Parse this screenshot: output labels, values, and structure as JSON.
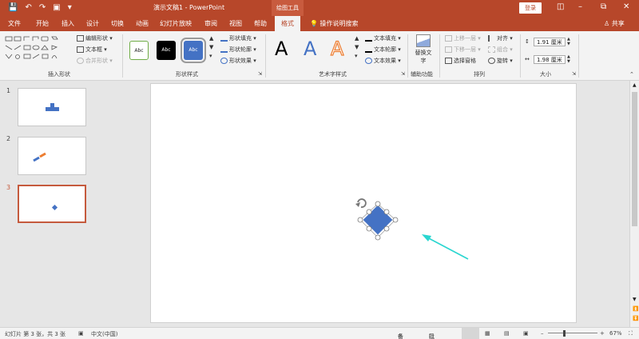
{
  "window": {
    "title": "演示文稿1 - PowerPoint",
    "context_tab_group": "绘图工具",
    "login_label": "登录"
  },
  "menu": {
    "tabs": [
      "文件",
      "开始",
      "插入",
      "设计",
      "切换",
      "动画",
      "幻灯片放映",
      "审阅",
      "视图",
      "帮助",
      "格式"
    ],
    "tell_me": "操作说明搜索",
    "share": "共享"
  },
  "ribbon": {
    "insert_shapes": {
      "label": "插入形状",
      "edit_shape": "编辑形状",
      "text_box": "文本框",
      "merge_shapes": "合并形状"
    },
    "shape_styles": {
      "label": "形状样式",
      "preset_text": "Abc",
      "fill": "形状填充",
      "outline": "形状轮廓",
      "effects": "形状效果"
    },
    "wordart": {
      "label": "艺术字样式",
      "letter": "A",
      "fill": "文本填充",
      "outline": "文本轮廓",
      "effects": "文本效果"
    },
    "accessibility": {
      "label": "辅助功能",
      "alt_text": "替换文字"
    },
    "arrange": {
      "label": "排列",
      "bring_forward": "上移一层",
      "send_backward": "下移一层",
      "selection_pane": "选择窗格",
      "align": "对齐",
      "group": "组合",
      "rotate": "旋转"
    },
    "size": {
      "label": "大小",
      "height": "1.91 厘米",
      "width": "1.98 厘米"
    }
  },
  "slides": [
    {
      "number": "1"
    },
    {
      "number": "2"
    },
    {
      "number": "3"
    }
  ],
  "status": {
    "slide_info": "幻灯片 第 3 张，共 3 张",
    "language": "中文(中国)",
    "notes": "备注",
    "comments": "批注",
    "zoom": "67%"
  },
  "colors": {
    "accent": "#b7472a",
    "shape_fill": "#4472c4",
    "arrow": "#2ad6d0"
  }
}
